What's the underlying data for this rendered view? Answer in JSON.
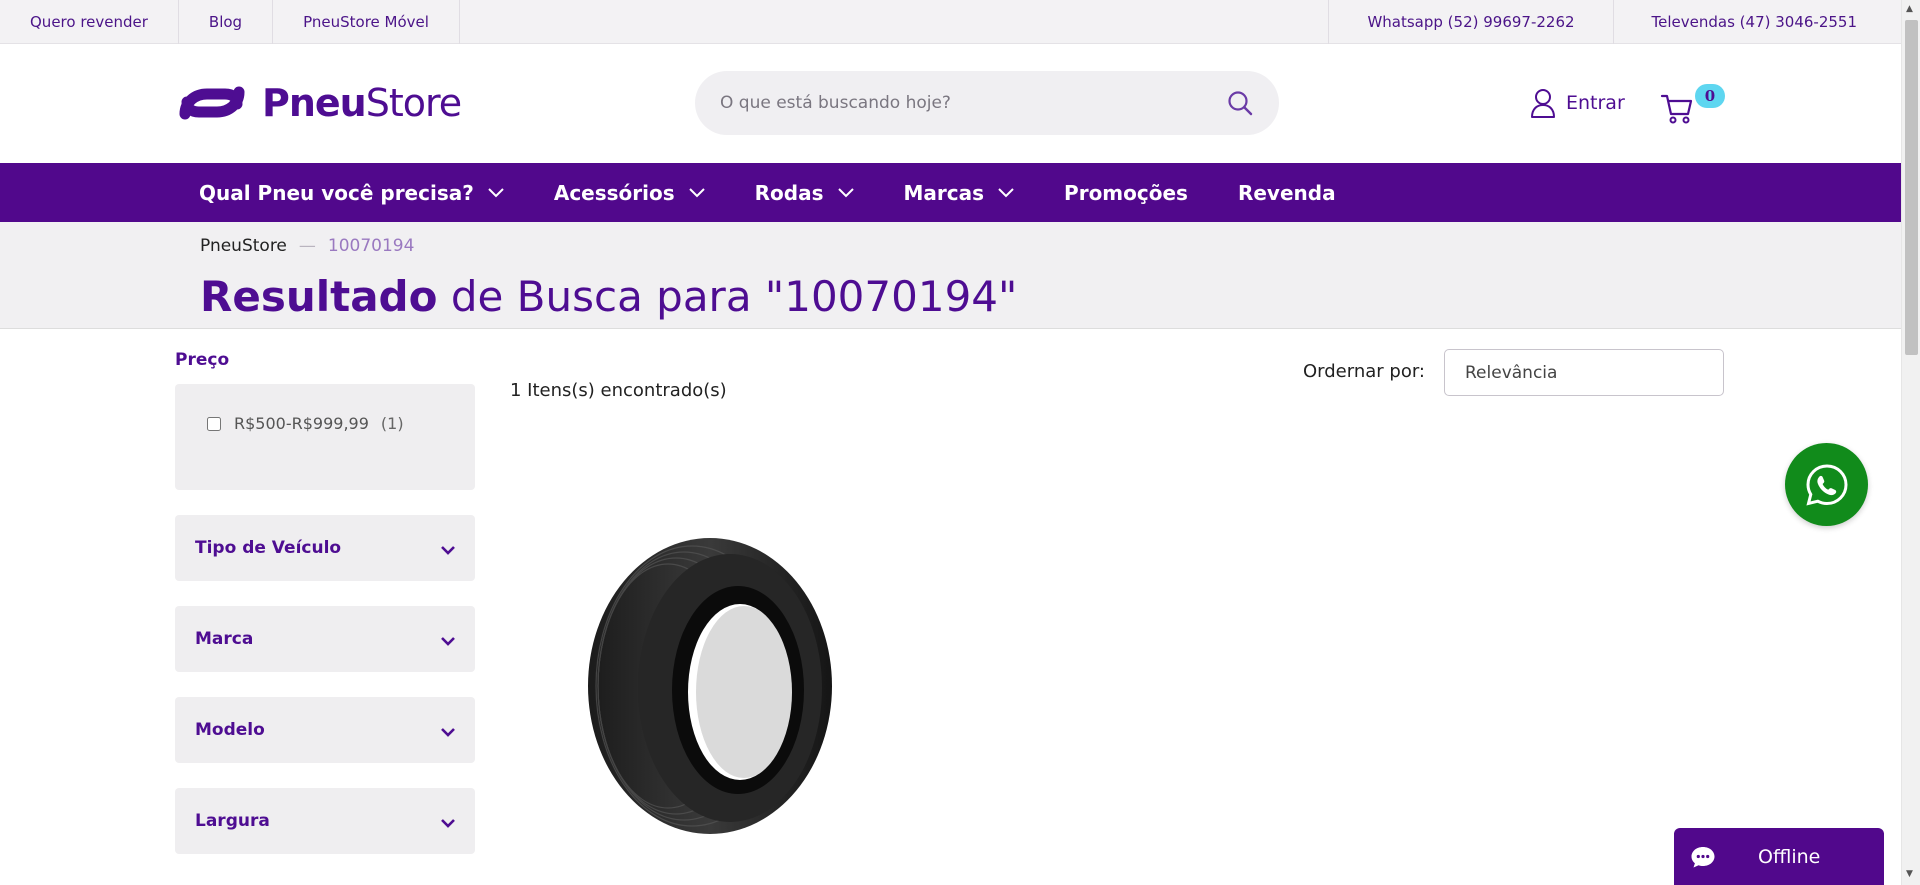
{
  "topbar": {
    "left_links": [
      "Quero revender",
      "Blog",
      "PneuStore Móvel"
    ],
    "right_links": [
      "Whatsapp (52) 99697-2262",
      "Televendas (47) 3046-2551"
    ]
  },
  "header": {
    "logo_bold": "Pneu",
    "logo_regular": "Store",
    "search_placeholder": "O que está buscando hoje?",
    "login_label": "Entrar",
    "cart_count": "0"
  },
  "nav": {
    "items": [
      {
        "label": "Qual Pneu você precisa?",
        "dropdown": true
      },
      {
        "label": "Acessórios",
        "dropdown": true
      },
      {
        "label": "Rodas",
        "dropdown": true
      },
      {
        "label": "Marcas",
        "dropdown": true
      },
      {
        "label": "Promoções",
        "dropdown": false
      },
      {
        "label": "Revenda",
        "dropdown": false
      }
    ]
  },
  "breadcrumb": {
    "home": "PneuStore",
    "separator": "—",
    "current": "10070194"
  },
  "page_title": {
    "bold": "Resultado",
    "rest": " de Busca para \"10070194\""
  },
  "filters": {
    "price_title": "Preço",
    "price_option": "R$500-R$999,99",
    "price_count": "(1)",
    "accordions": [
      "Tipo de Veículo",
      "Marca",
      "Modelo",
      "Largura"
    ]
  },
  "results": {
    "count_text": "1 Itens(s) encontrado(s)",
    "sort_label": "Ordernar por:",
    "sort_value": "Relevância"
  },
  "chat": {
    "status": "Offline"
  },
  "colors": {
    "brand_purple": "#51088c",
    "whatsapp_green": "#118b1b",
    "cart_badge": "#5ed6f0"
  }
}
